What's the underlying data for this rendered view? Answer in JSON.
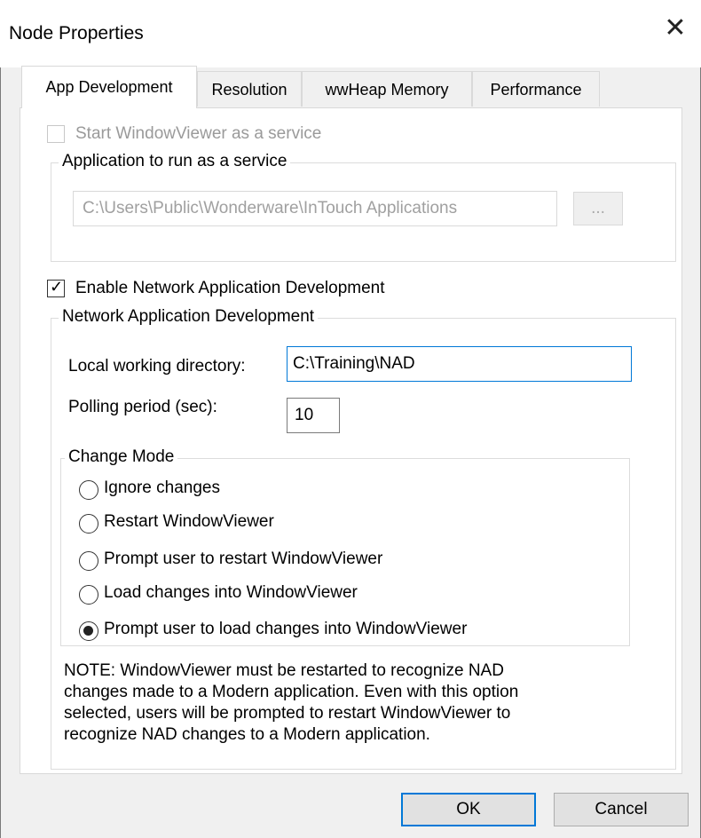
{
  "window": {
    "title": "Node Properties",
    "close_glyph": "✕"
  },
  "tabs": [
    {
      "label": "App Development",
      "active": true
    },
    {
      "label": "Resolution",
      "active": false
    },
    {
      "label": "wwHeap Memory",
      "active": false
    },
    {
      "label": "Performance",
      "active": false
    }
  ],
  "service": {
    "checkbox_label": "Start WindowViewer as a service",
    "checked": false,
    "group_label": "Application to run as a service",
    "path_value": "C:\\Users\\Public\\Wonderware\\InTouch Applications",
    "browse_label": "..."
  },
  "nad": {
    "checkbox_label": "Enable Network Application Development",
    "checked": true,
    "checkmark": "✓",
    "group_label": "Network Application Development",
    "local_dir_label": "Local working directory:",
    "local_dir_value": "C:\\Training\\NAD",
    "polling_label": "Polling period (sec):",
    "polling_value": "10"
  },
  "change_mode": {
    "group_label": "Change Mode",
    "options": [
      {
        "label": "Ignore changes",
        "selected": false
      },
      {
        "label": "Restart WindowViewer",
        "selected": false
      },
      {
        "label": "Prompt user to restart WindowViewer",
        "selected": false
      },
      {
        "label": "Load changes into WindowViewer",
        "selected": false
      },
      {
        "label": "Prompt user to load changes into WindowViewer",
        "selected": true
      }
    ]
  },
  "note": {
    "lines": [
      "NOTE: WindowViewer must be restarted to recognize NAD",
      "changes made to a Modern application. Even with this option",
      "selected, users will be prompted to restart WindowViewer to",
      "recognize NAD changes to a Modern application."
    ]
  },
  "footer": {
    "ok_label": "OK",
    "cancel_label": "Cancel"
  },
  "colors": {
    "focus_border": "#0078d7",
    "disabled_text": "#a0a0a0"
  }
}
